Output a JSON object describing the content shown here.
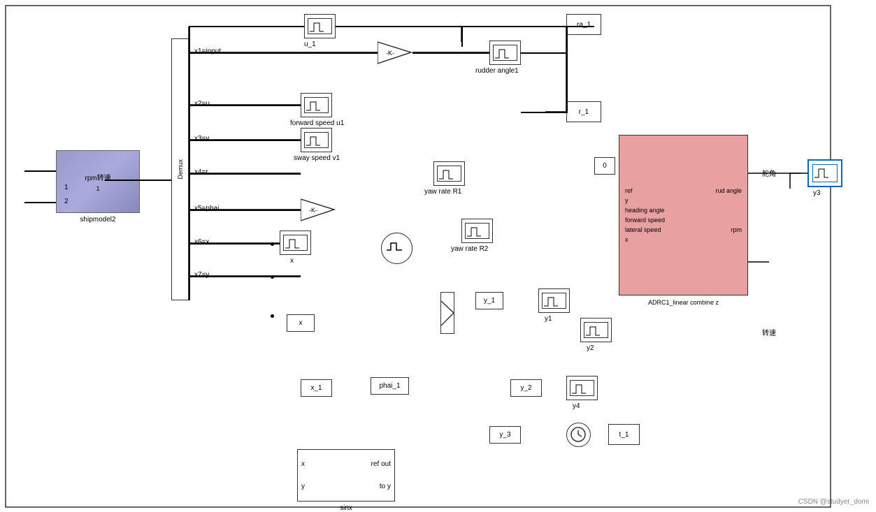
{
  "blocks": {
    "shipmodel": {
      "label": "rpm转速\nshipmodel2",
      "label1": "rpm转速",
      "label2": "shipmodel2"
    },
    "demux": {
      "label": "Demux"
    },
    "u1_scope": {
      "label": "u_1"
    },
    "gain1": {
      "label": "-K-"
    },
    "rudder_angle1_scope": {
      "label": "rudder angle1"
    },
    "ra1_block": {
      "label": "ra_1"
    },
    "r1_block": {
      "label": "r_1"
    },
    "forward_speed_scope": {
      "label": "forward speed u1"
    },
    "sway_speed_scope": {
      "label": "sway speed v1"
    },
    "yaw_rate_r1_scope": {
      "label": "yaw rate R1"
    },
    "gain2": {
      "label": "-K-"
    },
    "yaw_rate_r2_scope": {
      "label": "yaw rate R2"
    },
    "x_scope": {
      "label": "x"
    },
    "x_block": {
      "label": "x"
    },
    "y1_scope": {
      "label": "y1"
    },
    "y_1_block": {
      "label": "y_1"
    },
    "y2_scope": {
      "label": "y2"
    },
    "x_1_block": {
      "label": "x_1"
    },
    "phai_1_block": {
      "label": "phai_1"
    },
    "y_2_block": {
      "label": "y_2"
    },
    "y4_scope": {
      "label": "y4"
    },
    "y_3_block": {
      "label": "y_3"
    },
    "clock_block": {
      "label": "⊙"
    },
    "t_1_block": {
      "label": "t_1"
    },
    "sinx_block": {
      "label": "sinx",
      "label_x": "x",
      "label_y": "y",
      "label_ref": "ref out",
      "label_toy": "to y"
    },
    "adrc_block": {
      "label": "ADRC1_linear combine z",
      "inputs": [
        "ref",
        "y",
        "heading angle",
        "forward speed",
        "lateral speed",
        "x"
      ],
      "outputs": [
        "rud angle",
        "rpm"
      ]
    },
    "y3_scope": {
      "label": "y3"
    },
    "zero_block": {
      "label": "0"
    }
  },
  "labels": {
    "x1_input": "x1=input",
    "x2_u": "x2=u",
    "x3_v": "x3=v",
    "x4_r": "x4=r",
    "x5_phai": "x5=phai",
    "x6_x": "x6=x",
    "x7_y": "x7=y",
    "rudder_angle1_text": "rudder angle1",
    "rudder_angle_cn": "舵角",
    "rpm_cn": "转速",
    "y3_label": "y3",
    "watermark": "CSDN @studyer_domi",
    "port1": "1",
    "port2": "2"
  }
}
